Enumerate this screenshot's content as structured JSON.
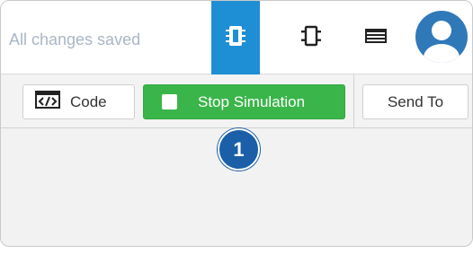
{
  "header": {
    "status": "All changes saved",
    "views": [
      {
        "name": "circuit-view",
        "icon": "chip-icon",
        "active": true
      },
      {
        "name": "component-view",
        "icon": "component-icon",
        "active": false
      },
      {
        "name": "list-view",
        "icon": "list-icon",
        "active": false
      }
    ],
    "avatar_icon": "user-avatar-icon"
  },
  "toolbar": {
    "code_label": "Code",
    "simulation_label": "Stop Simulation",
    "send_label": "Send To"
  },
  "callout": {
    "number": "1"
  },
  "colors": {
    "accent_blue": "#1f8fd5",
    "sim_green": "#3ab54a",
    "callout_blue": "#1a5fa8",
    "avatar_blue": "#2f79b9"
  }
}
